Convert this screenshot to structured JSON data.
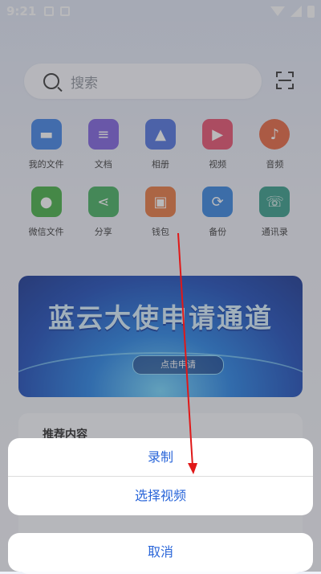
{
  "status_bar": {
    "time": "9:21"
  },
  "search": {
    "placeholder": "搜索"
  },
  "apps": [
    {
      "label": "我的文件",
      "color": "#3a7fe6",
      "icon": "folder-icon"
    },
    {
      "label": "文档",
      "color": "#7b5de0",
      "icon": "document-icon"
    },
    {
      "label": "相册",
      "color": "#4a6fe0",
      "icon": "photo-icon"
    },
    {
      "label": "视频",
      "color": "#e84a6a",
      "icon": "video-icon"
    },
    {
      "label": "音频",
      "color": "#e8623a",
      "icon": "music-icon"
    },
    {
      "label": "微信文件",
      "color": "#3fae3f",
      "icon": "wechat-icon"
    },
    {
      "label": "分享",
      "color": "#3fae5a",
      "icon": "share-icon"
    },
    {
      "label": "钱包",
      "color": "#e8733a",
      "icon": "wallet-icon"
    },
    {
      "label": "备份",
      "color": "#2f80e0",
      "icon": "backup-icon"
    },
    {
      "label": "通讯录",
      "color": "#2f9a86",
      "icon": "contacts-icon"
    }
  ],
  "banner": {
    "title": "蓝云大使申请通道",
    "button": "点击申请"
  },
  "recommend": {
    "title": "推荐内容"
  },
  "action_sheet": {
    "options": [
      "录制",
      "选择视频"
    ],
    "cancel": "取消"
  },
  "accent_color": "#2a66d9"
}
